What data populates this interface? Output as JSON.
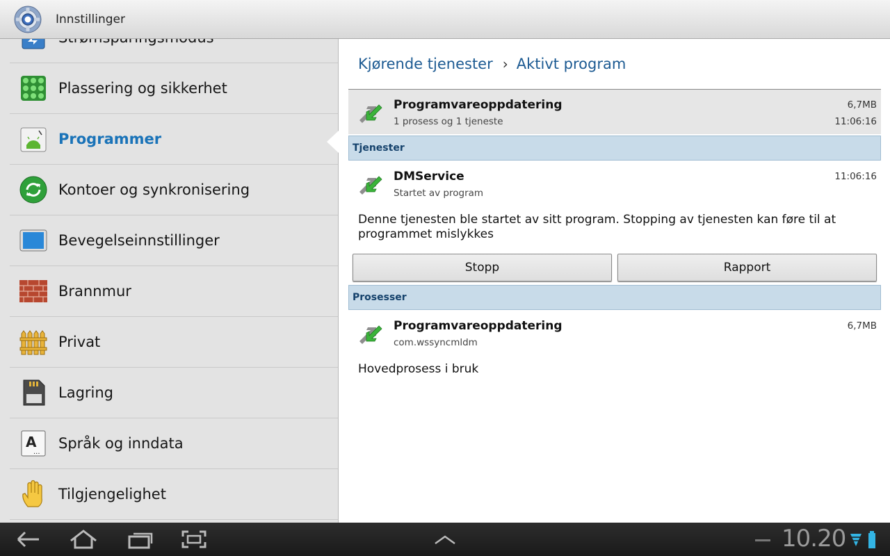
{
  "titlebar": {
    "title": "Innstillinger",
    "icon": "gear-icon"
  },
  "sidebar": {
    "partial_item": {
      "label": "Strømsparingsmodus",
      "icon": "power-saving-icon"
    },
    "items": [
      {
        "label": "Plassering og sikkerhet",
        "icon": "location-grid-icon"
      },
      {
        "label": "Programmer",
        "icon": "android-icon",
        "selected": true
      },
      {
        "label": "Kontoer og synkronisering",
        "icon": "sync-icon"
      },
      {
        "label": "Bevegelseinnstillinger",
        "icon": "tablet-icon"
      },
      {
        "label": "Brannmur",
        "icon": "brick-wall-icon"
      },
      {
        "label": "Privat",
        "icon": "fence-icon"
      },
      {
        "label": "Lagring",
        "icon": "sd-card-icon"
      },
      {
        "label": "Språk og inndata",
        "icon": "keyboard-a-icon"
      },
      {
        "label": "Tilgjengelighet",
        "icon": "hand-icon"
      }
    ],
    "selected_color": "#1a73b8"
  },
  "breadcrumb": {
    "parent": "Kjørende tjenester",
    "current": "Aktivt program"
  },
  "app": {
    "name": "Programvareoppdatering",
    "summary": "1 prosess og 1 tjeneste",
    "size": "6,7MB",
    "time": "11:06:16"
  },
  "services": {
    "header": "Tjenester",
    "name": "DMService",
    "sub": "Startet av program",
    "time": "11:06:16",
    "description": "Denne tjenesten ble startet av sitt program. Stopping av tjenesten kan føre til at programmet mislykkes",
    "stop_label": "Stopp",
    "report_label": "Rapport"
  },
  "processes": {
    "header": "Prosesser",
    "name": "Programvareoppdatering",
    "package": "com.wssyncmldm",
    "size": "6,7MB",
    "status": "Hovedprosess i bruk"
  },
  "systembar": {
    "clock": "10.20",
    "accent": "#33b5e5"
  }
}
